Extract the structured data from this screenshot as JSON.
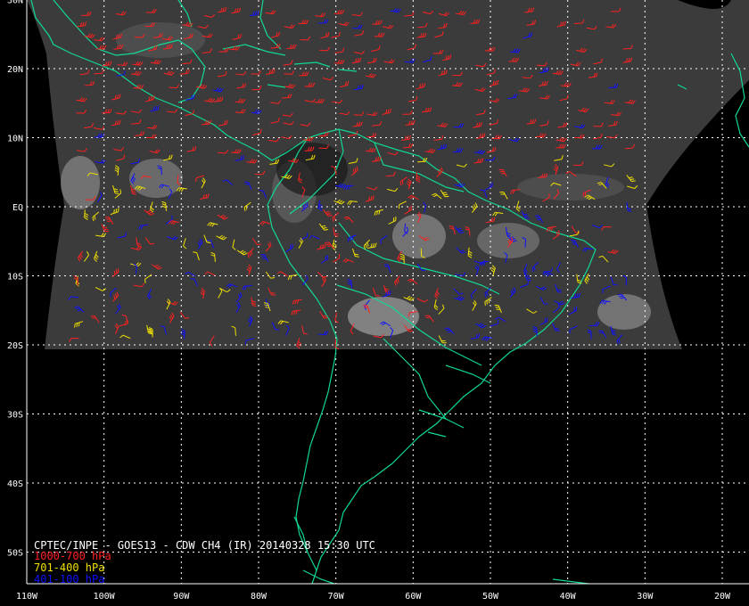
{
  "title": "CPTEC/INPE - GOES13 - CDW CH4 (IR) 20140328 15:30 UTC",
  "legend": [
    {
      "label": "1000-700 hPa",
      "color": "#ff2020"
    },
    {
      "label": "701-400 hPa",
      "color": "#f0e000"
    },
    {
      "label": "401-100 hPa",
      "color": "#1010ff"
    }
  ],
  "colors": {
    "coastline": "#10d890",
    "grid": "#ffffff",
    "background": "#000000",
    "satellite_image": "#3a3a3a"
  },
  "latitude_labels": [
    {
      "label": "30N",
      "lat": 30
    },
    {
      "label": "20N",
      "lat": 20
    },
    {
      "label": "10N",
      "lat": 10
    },
    {
      "label": "EQ",
      "lat": 0
    },
    {
      "label": "10S",
      "lat": -10
    },
    {
      "label": "20S",
      "lat": -20
    },
    {
      "label": "30S",
      "lat": -30
    },
    {
      "label": "40S",
      "lat": -40
    },
    {
      "label": "50S",
      "lat": -50
    }
  ],
  "longitude_labels": [
    {
      "label": "110W",
      "lon": -110
    },
    {
      "label": "100W",
      "lon": -100
    },
    {
      "label": "90W",
      "lon": -90
    },
    {
      "label": "80W",
      "lon": -80
    },
    {
      "label": "70W",
      "lon": -70
    },
    {
      "label": "60W",
      "lon": -60
    },
    {
      "label": "50W",
      "lon": -50
    },
    {
      "label": "40W",
      "lon": -40
    },
    {
      "label": "30W",
      "lon": -30
    },
    {
      "label": "20W",
      "lon": -20
    }
  ],
  "map_extent": {
    "lon_min": -110,
    "lon_max": -10,
    "lat_min": -55,
    "lat_max": 30
  },
  "satellite_extent": {
    "lon_min": -105,
    "lon_max": -30,
    "lat_min": -20,
    "lat_max": 30
  }
}
